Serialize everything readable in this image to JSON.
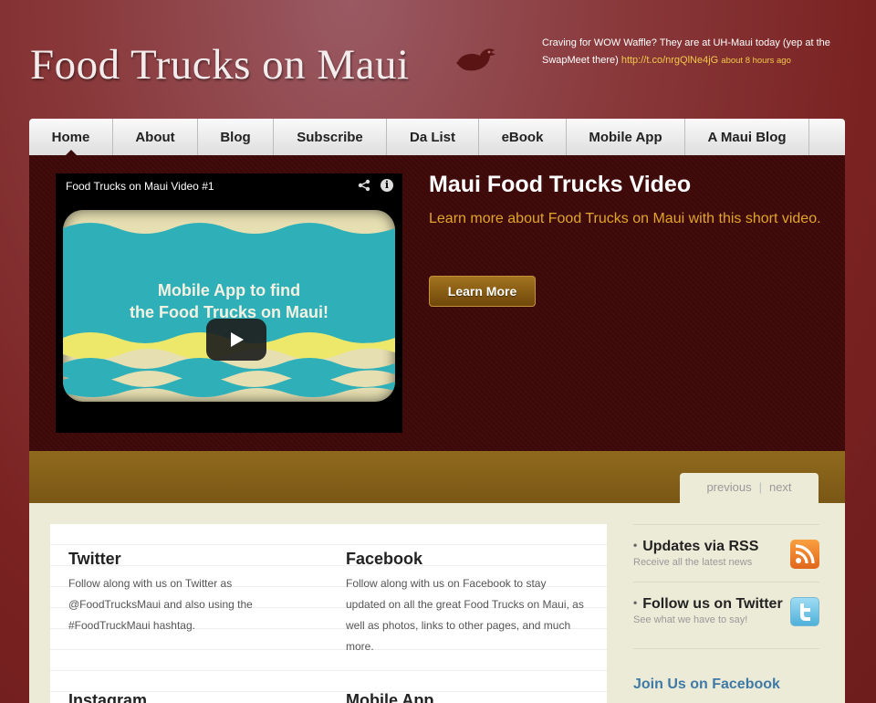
{
  "header": {
    "site_title": "Food Trucks on Maui",
    "tweet": {
      "text": "Craving for WOW Waffle? They are at UH-Maui today (yep at the SwapMeet there)",
      "link": "http://t.co/nrgQlNe4jG",
      "time": "about 8 hours ago"
    }
  },
  "nav": {
    "items": [
      {
        "label": "Home"
      },
      {
        "label": "About"
      },
      {
        "label": "Blog"
      },
      {
        "label": "Subscribe"
      },
      {
        "label": "Da List"
      },
      {
        "label": "eBook"
      },
      {
        "label": "Mobile App"
      },
      {
        "label": "A Maui Blog"
      }
    ]
  },
  "feature": {
    "video_title": "Food Trucks on Maui Video #1",
    "thumbnail_text_line1": "Mobile App to find",
    "thumbnail_text_line2": "the Food Trucks on Maui!",
    "title": "Maui Food Trucks Video",
    "description": "Learn more about Food Trucks on Maui with this short video.",
    "button_label": "Learn More"
  },
  "pager": {
    "previous": "previous",
    "next": "next"
  },
  "main": {
    "twitter": {
      "title": "Twitter",
      "text": "Follow along with us on Twitter as @FoodTrucksMaui and also using the #FoodTruckMaui hashtag."
    },
    "facebook": {
      "title": "Facebook",
      "text": "Follow along with us on Facebook to stay updated on all the great Food Trucks on Maui, as well as photos, links to other pages, and much more."
    },
    "instagram": {
      "title": "Instagram"
    },
    "mobile_app": {
      "title": "Mobile App"
    }
  },
  "sidebar": {
    "rss": {
      "title": "Updates via RSS",
      "subtitle": "Receive all the latest news"
    },
    "twitter": {
      "title": "Follow us on Twitter",
      "subtitle": "See what we have to say!"
    },
    "facebook_link": "Join Us on Facebook"
  },
  "colors": {
    "background": "#7a2222",
    "feature_bg": "#3c0909",
    "accent_gold": "#e0a52a",
    "link_blue": "#3f7aa6",
    "content_bg": "#ecebd7"
  }
}
